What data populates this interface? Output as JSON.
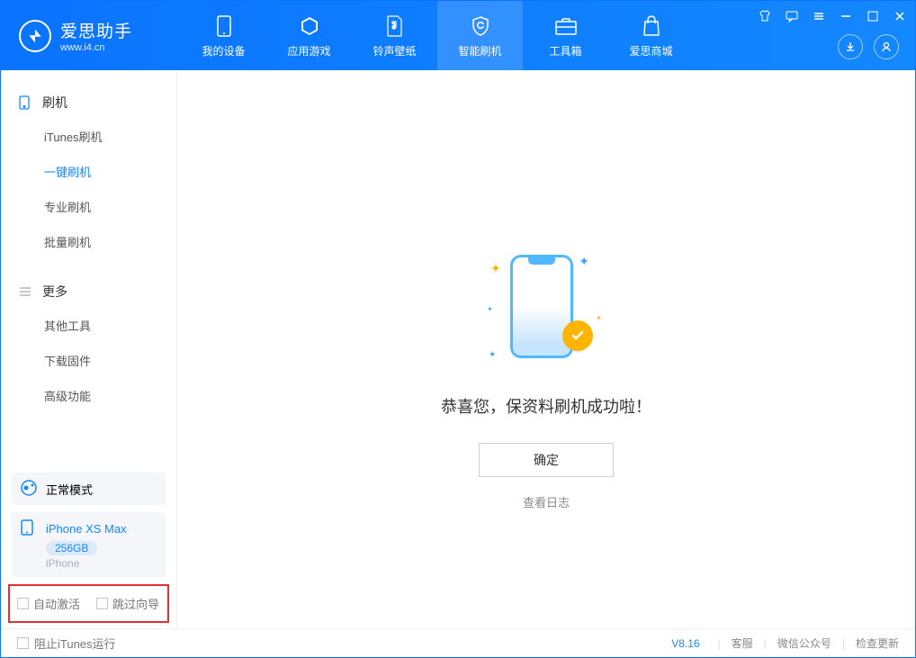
{
  "app": {
    "title": "爱思助手",
    "url": "www.i4.cn"
  },
  "nav": {
    "tabs": [
      {
        "label": "我的设备"
      },
      {
        "label": "应用游戏"
      },
      {
        "label": "铃声壁纸"
      },
      {
        "label": "智能刷机"
      },
      {
        "label": "工具箱"
      },
      {
        "label": "爱思商城"
      }
    ]
  },
  "sidebar": {
    "section1_title": "刷机",
    "section1_items": [
      {
        "label": "iTunes刷机"
      },
      {
        "label": "一键刷机"
      },
      {
        "label": "专业刷机"
      },
      {
        "label": "批量刷机"
      }
    ],
    "section2_title": "更多",
    "section2_items": [
      {
        "label": "其他工具"
      },
      {
        "label": "下载固件"
      },
      {
        "label": "高级功能"
      }
    ],
    "mode_label": "正常模式",
    "device_name": "iPhone XS Max",
    "device_storage": "256GB",
    "device_type": "iPhone",
    "cb_auto_activate": "自动激活",
    "cb_skip_guide": "跳过向导"
  },
  "main": {
    "success_text": "恭喜您，保资料刷机成功啦！",
    "confirm_label": "确定",
    "view_log_label": "查看日志"
  },
  "footer": {
    "stop_itunes": "阻止iTunes运行",
    "version": "V8.16",
    "customer_service": "客服",
    "wechat": "微信公众号",
    "check_update": "检查更新"
  }
}
